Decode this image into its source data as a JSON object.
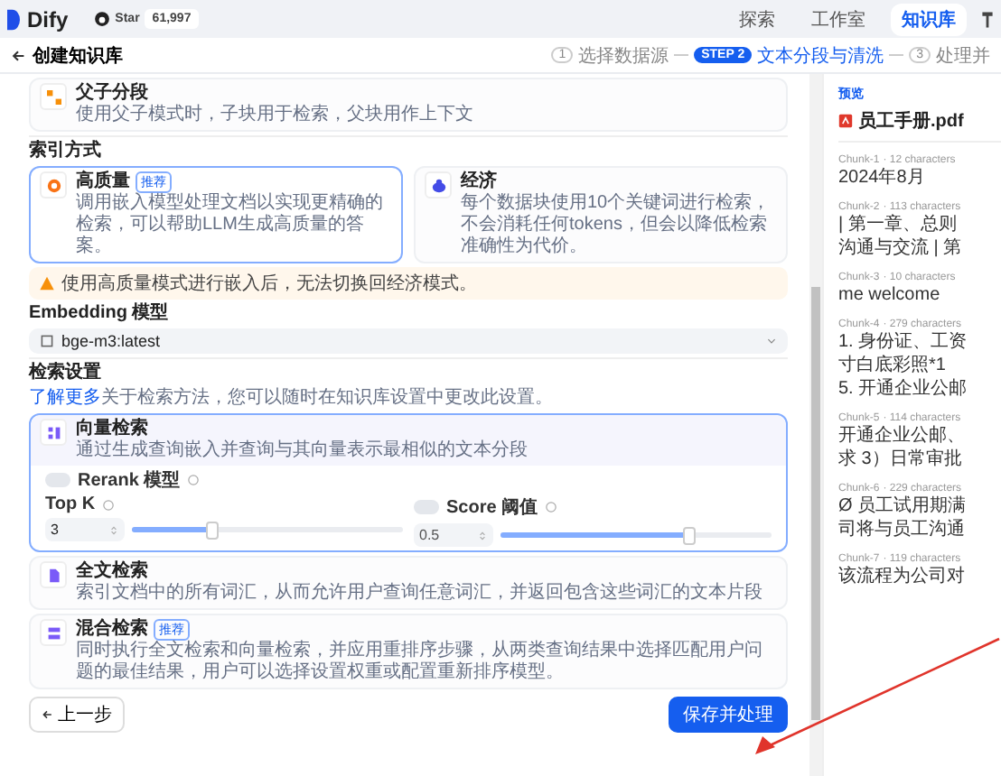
{
  "header": {
    "logo": "Dify",
    "star_label": "Star",
    "star_count": "61,997",
    "nav": [
      {
        "label": "探索",
        "selected": false
      },
      {
        "label": "工作室",
        "selected": false
      },
      {
        "label": "知识库",
        "selected": true
      }
    ]
  },
  "subheader": {
    "back": "创建知识库",
    "steps": [
      {
        "badge": "1",
        "label": "选择数据源",
        "selected": false
      },
      {
        "badge": "STEP 2",
        "label": "文本分段与清洗",
        "selected": true
      },
      {
        "badge": "3",
        "label": "处理并",
        "selected": false
      }
    ]
  },
  "parent_child": {
    "title": "父子分段",
    "description": "使用父子模式时，子块用于检索，父块用作上下文"
  },
  "index_method": {
    "title": "索引方式",
    "options": [
      {
        "kind": "quality",
        "title": "高质量",
        "badge": "推荐",
        "description": "调用嵌入模型处理文档以实现更精确的检索，可以帮助LLM生成高质量的答案。",
        "selected": true
      },
      {
        "kind": "economy",
        "title": "经济",
        "description": "每个数据块使用10个关键词进行检索，不会消耗任何tokens，但会以降低检索准确性为代价。",
        "selected": false
      }
    ],
    "warning": "使用高质量模式进行嵌入后，无法切换回经济模式。"
  },
  "embedding": {
    "label": "Embedding 模型",
    "value": "bge-m3:latest"
  },
  "retrieval": {
    "title": "检索设置",
    "link": "了解更多",
    "note": "关于检索方法，您可以随时在知识库设置中更改此设置。",
    "methods": [
      {
        "kind": "vector",
        "title": "向量检索",
        "description": "通过生成查询嵌入并查询与其向量表示最相似的文本分段",
        "selected": true
      },
      {
        "kind": "fulltext",
        "title": "全文检索",
        "description": "索引文档中的所有词汇，从而允许用户查询任意词汇，并返回包含这些词汇的文本片段",
        "selected": false
      },
      {
        "kind": "hybrid",
        "title": "混合检索",
        "badge": "推荐",
        "description": "同时执行全文检索和向量检索，并应用重排序步骤，从两类查询结果中选择匹配用户问题的最佳结果，用户可以选择设置权重或配置重新排序模型。",
        "selected": false
      }
    ],
    "rerank": {
      "label": "Rerank 模型",
      "on": false
    },
    "top_k": {
      "label": "Top K",
      "value": "3",
      "level": 0.3
    },
    "score": {
      "label": "Score 阈值",
      "on": false,
      "value": "0.5",
      "level": 0.7
    }
  },
  "buttons": {
    "back": "上一步",
    "save": "保存并处理"
  },
  "preview": {
    "label": "预览",
    "file": "员工手册.pdf",
    "chunks": [
      {
        "title": "Chunk-1",
        "meta": "· 12 characters",
        "lines": [
          "2024年8月"
        ]
      },
      {
        "title": "Chunk-2",
        "meta": "· 113 characters",
        "lines": [
          "| 第一章、总则",
          "沟通与交流 | 第"
        ]
      },
      {
        "title": "Chunk-3",
        "meta": "· 10 characters",
        "lines": [
          "me welcome"
        ]
      },
      {
        "title": "Chunk-4",
        "meta": "· 279 characters",
        "lines": [
          "1. 身份证、工资",
          "寸白底彩照*1",
          "5. 开通企业公邮"
        ]
      },
      {
        "title": "Chunk-5",
        "meta": "· 114 characters",
        "lines": [
          "开通企业公邮、",
          "求 3）日常审批"
        ]
      },
      {
        "title": "Chunk-6",
        "meta": "· 229 characters",
        "lines": [
          "Ø 员工试用期满",
          "司将与员工沟通"
        ]
      },
      {
        "title": "Chunk-7",
        "meta": "· 119 characters",
        "lines": [
          "该流程为公司对"
        ]
      }
    ]
  }
}
